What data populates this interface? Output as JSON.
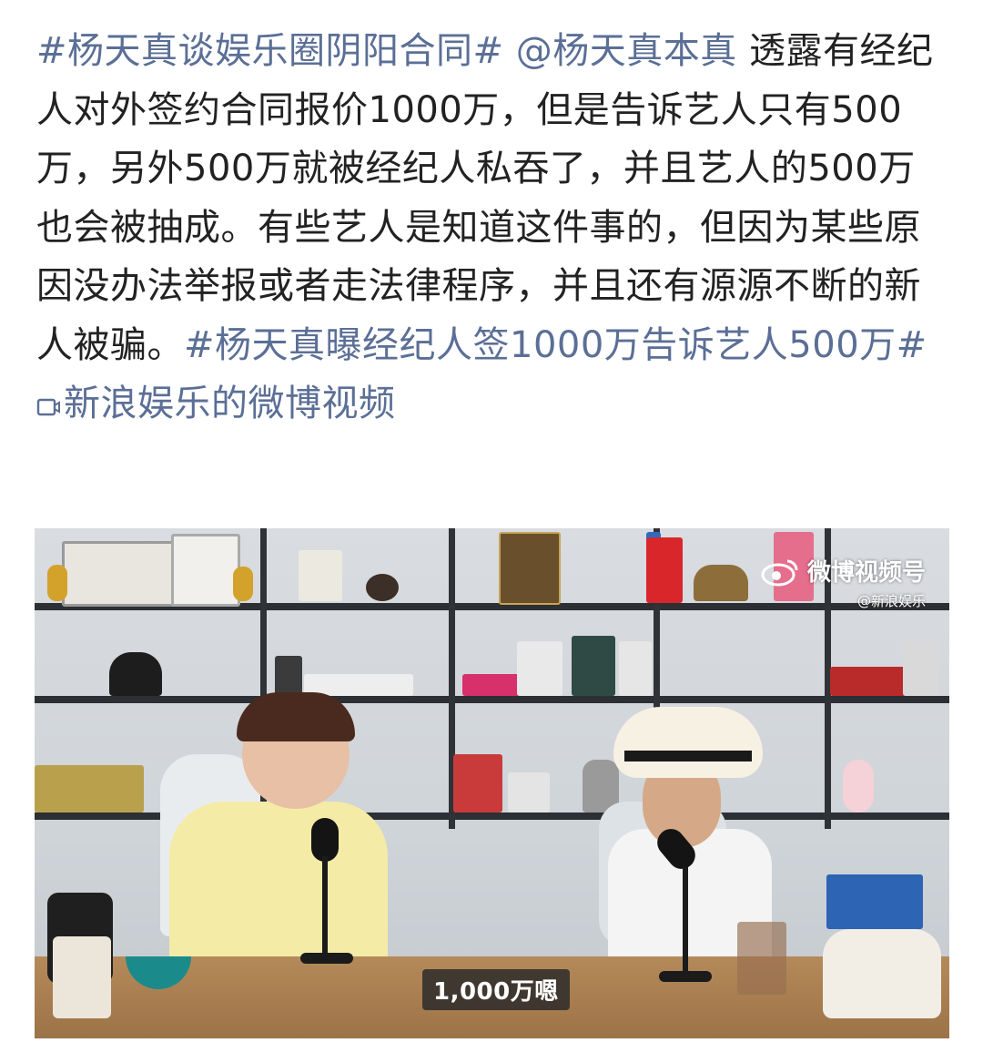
{
  "post": {
    "hashtag1": "#杨天真谈娱乐圈阴阳合同#",
    "mention": "@杨天真本真",
    "body": "透露有经纪人对外签约合同报价1000万，但是告诉艺人只有500万，另外500万就被经纪人私吞了，并且艺人的500万也会被抽成。有些艺人是知道这件事的，但因为某些原因没办法举报或者走法律程序，并且还有源源不断的新人被骗。",
    "hashtag2": "#杨天真曝经纪人签1000万告诉艺人500万#",
    "video_link": "新浪娱乐的微博视频"
  },
  "video": {
    "subtitle": "1,000万嗯",
    "watermark_title": "微博视频号",
    "watermark_sub": "@新浪娱乐",
    "icons": [
      "weibo-logo-icon",
      "video-link-icon"
    ]
  },
  "colors": {
    "link": "#5b6f96",
    "text": "#222222"
  }
}
